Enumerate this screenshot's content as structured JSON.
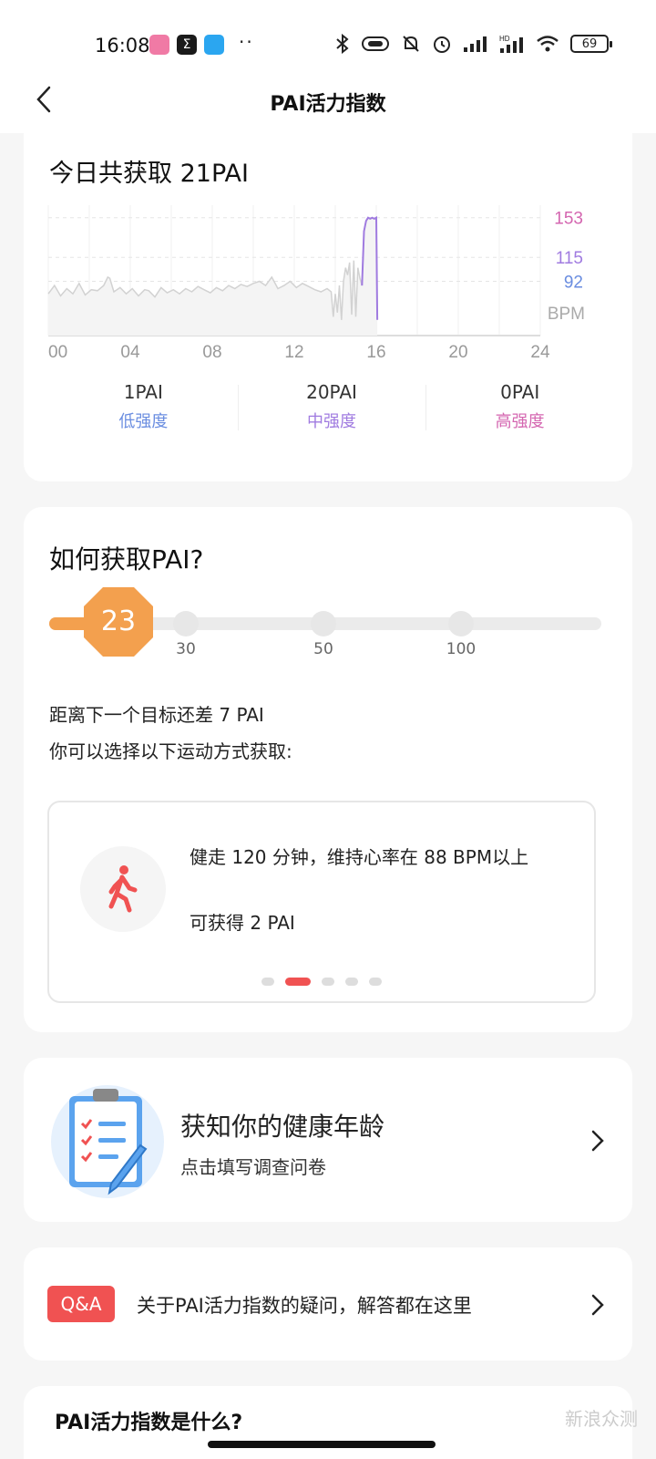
{
  "status_bar": {
    "time": "16:08",
    "battery": "69",
    "dots": "··",
    "icons": [
      "bilibili-icon",
      "sigma-app-icon",
      "cloud-app-icon",
      "bluetooth-icon",
      "vibrate-icon",
      "mute-icon",
      "alarm-icon",
      "signal-icon",
      "hd-signal-icon",
      "wifi-icon",
      "battery-icon"
    ]
  },
  "nav": {
    "title": "PAI活力指数"
  },
  "today": {
    "title": "今日共获取 21PAI",
    "chart_data": {
      "type": "line",
      "title": "今日共获取 21PAI",
      "xlabel": "",
      "ylabel": "BPM",
      "x_ticks": [
        "00",
        "04",
        "08",
        "12",
        "16",
        "20",
        "24"
      ],
      "y_reference_lines": [
        {
          "value": 153,
          "label": "153",
          "color": "#d466b0"
        },
        {
          "value": 115,
          "label": "115",
          "color": "#a07be0"
        },
        {
          "value": 92,
          "label": "92",
          "color": "#6a8de0"
        }
      ],
      "y_unit": "BPM",
      "xlim": [
        0,
        24
      ],
      "ylim": [
        40,
        165
      ],
      "series": [
        {
          "x": [
            0,
            0.3,
            0.6,
            0.9,
            1.2,
            1.5,
            1.8,
            2.1,
            2.4,
            2.7,
            2.9,
            3.0,
            3.2,
            3.5,
            3.8,
            4.1,
            4.4,
            4.7,
            4.9,
            5.2,
            5.5,
            5.8,
            6.1,
            6.4,
            6.7,
            7.0,
            7.3,
            7.6,
            7.9,
            8.2,
            8.5,
            8.8,
            9.1,
            9.4,
            9.7,
            10.0,
            10.3,
            10.6,
            10.9,
            11.2,
            11.5,
            11.8,
            12.1,
            12.4,
            12.7,
            13.0,
            13.3,
            13.6,
            13.8,
            13.9,
            14.0,
            14.1,
            14.2,
            14.3,
            14.4,
            14.5,
            14.6,
            14.7,
            14.8,
            14.9,
            15.0,
            15.1,
            15.2,
            15.3,
            15.4,
            15.5,
            15.6,
            15.7,
            15.8,
            15.9,
            16.0,
            16.05
          ],
          "y": [
            80,
            88,
            78,
            85,
            80,
            90,
            79,
            84,
            83,
            88,
            96,
            95,
            82,
            86,
            80,
            85,
            78,
            84,
            83,
            77,
            86,
            81,
            84,
            80,
            85,
            82,
            87,
            84,
            81,
            86,
            83,
            88,
            85,
            89,
            87,
            90,
            92,
            88,
            96,
            85,
            88,
            92,
            86,
            90,
            87,
            84,
            82,
            85,
            82,
            58,
            80,
            62,
            88,
            55,
            92,
            105,
            98,
            110,
            60,
            112,
            58,
            105,
            95,
            88,
            140,
            150,
            153,
            152,
            153,
            152,
            153,
            55
          ]
        }
      ]
    },
    "stats": [
      {
        "value": "1PAI",
        "label": "低强度",
        "color": "#6a8de0"
      },
      {
        "value": "20PAI",
        "label": "中强度",
        "color": "#a07be0"
      },
      {
        "value": "0PAI",
        "label": "高强度",
        "color": "#d466b0"
      }
    ]
  },
  "howto": {
    "title": "如何获取PAI?",
    "current_value": "23",
    "progress_fraction": 0.23,
    "milestones": [
      "30",
      "50",
      "100"
    ],
    "goal_text": "距离下一个目标还差 7 PAI",
    "choose_text": "你可以选择以下运动方式获取:",
    "suggestion": {
      "text": "健走 120 分钟，维持心率在 88 BPM以上",
      "reward": "可获得 2 PAI",
      "icon": "walking-person-icon"
    },
    "pager": {
      "count": 5,
      "active_index": 1
    }
  },
  "age": {
    "title": "获知你的健康年龄",
    "subtitle": "点击填写调查问卷",
    "icon": "clipboard-checklist-icon"
  },
  "qa": {
    "badge": "Q&A",
    "text": "关于PAI活力指数的疑问，解答都在这里"
  },
  "what": {
    "title": "PAI活力指数是什么?"
  },
  "watermark": "新浪众测",
  "colors": {
    "accent_orange": "#f3a04e",
    "accent_red": "#f05252",
    "low": "#6a8de0",
    "mid": "#a07be0",
    "high": "#d466b0"
  }
}
